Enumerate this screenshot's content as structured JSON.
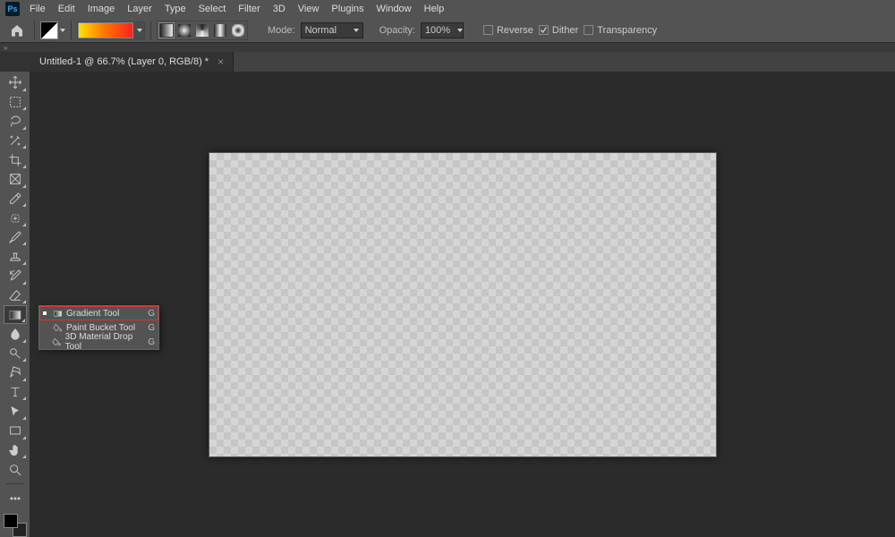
{
  "menu": [
    "File",
    "Edit",
    "Image",
    "Layer",
    "Type",
    "Select",
    "Filter",
    "3D",
    "View",
    "Plugins",
    "Window",
    "Help"
  ],
  "options": {
    "mode_label": "Mode:",
    "mode_value": "Normal",
    "opacity_label": "Opacity:",
    "opacity_value": "100%",
    "reverse": {
      "label": "Reverse",
      "checked": false
    },
    "dither": {
      "label": "Dither",
      "checked": true
    },
    "transparency": {
      "label": "Transparency",
      "checked": false
    }
  },
  "doc_tab": "Untitled-1 @ 66.7% (Layer 0, RGB/8) *",
  "tools": [
    {
      "name": "move-tool"
    },
    {
      "name": "marquee-tool"
    },
    {
      "name": "lasso-tool"
    },
    {
      "name": "magic-wand-tool"
    },
    {
      "name": "crop-tool"
    },
    {
      "name": "frame-tool"
    },
    {
      "name": "eyedropper-tool"
    },
    {
      "name": "healing-brush-tool"
    },
    {
      "name": "brush-tool"
    },
    {
      "name": "clone-stamp-tool"
    },
    {
      "name": "history-brush-tool"
    },
    {
      "name": "eraser-tool"
    },
    {
      "name": "gradient-tool",
      "selected": true
    },
    {
      "name": "blur-tool"
    },
    {
      "name": "dodge-tool"
    },
    {
      "name": "pen-tool"
    },
    {
      "name": "type-tool"
    },
    {
      "name": "path-selection-tool"
    },
    {
      "name": "rectangle-tool"
    },
    {
      "name": "hand-tool"
    },
    {
      "name": "zoom-tool"
    }
  ],
  "flyout": {
    "items": [
      {
        "label": "Gradient Tool",
        "shortcut": "G",
        "active": true
      },
      {
        "label": "Paint Bucket Tool",
        "shortcut": "G",
        "active": false
      },
      {
        "label": "3D Material Drop Tool",
        "shortcut": "G",
        "active": false
      }
    ]
  },
  "logo": "Ps"
}
